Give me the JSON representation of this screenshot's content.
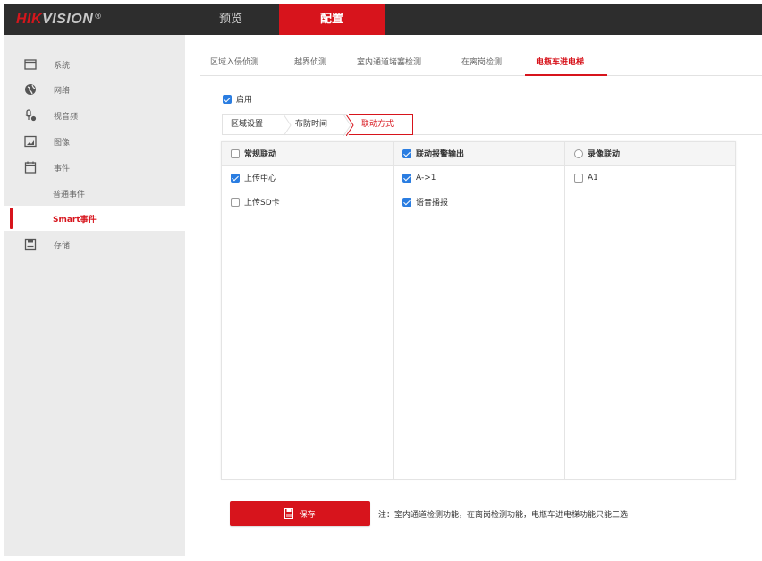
{
  "header": {
    "logo_brand": "HIK",
    "logo_rest": "VISION",
    "logo_mark": "®",
    "nav": [
      {
        "label": "预览",
        "active": false
      },
      {
        "label": "配置",
        "active": true
      }
    ],
    "accent_color": "#d7141c",
    "bar_color": "#2d2d2d"
  },
  "sidebar": {
    "items": [
      {
        "label": "系统",
        "icon": "monitor-icon"
      },
      {
        "label": "网络",
        "icon": "globe-icon"
      },
      {
        "label": "视音频",
        "icon": "audio-video-icon"
      },
      {
        "label": "图像",
        "icon": "image-icon"
      },
      {
        "label": "事件",
        "icon": "calendar-icon"
      },
      {
        "label": "存储",
        "icon": "storage-icon"
      }
    ],
    "sub_items": [
      {
        "label": "普通事件",
        "active": false
      },
      {
        "label": "Smart事件",
        "active": true
      }
    ]
  },
  "tabs": [
    {
      "label": "区域入侵侦测",
      "active": false
    },
    {
      "label": "越界侦测",
      "active": false
    },
    {
      "label": "室内通道堵塞检测",
      "active": false
    },
    {
      "label": "在离岗检测",
      "active": false
    },
    {
      "label": "电瓶车进电梯",
      "active": true
    }
  ],
  "enable": {
    "label": "启用",
    "checked": true
  },
  "steps": [
    {
      "label": "区域设置",
      "active": false
    },
    {
      "label": "布防时间",
      "active": false
    },
    {
      "label": "联动方式",
      "active": true
    }
  ],
  "linkage": {
    "columns": [
      {
        "header": "常规联动",
        "checked": false,
        "items": [
          {
            "label": "上传中心",
            "checked": true
          },
          {
            "label": "上传SD卡",
            "checked": false
          }
        ]
      },
      {
        "header": "联动报警输出",
        "checked": true,
        "items": [
          {
            "label": "A->1",
            "checked": true
          },
          {
            "label": "语音播报",
            "checked": true
          }
        ]
      },
      {
        "header": "录像联动",
        "checked": false,
        "items": [
          {
            "label": "A1",
            "checked": false
          }
        ]
      }
    ]
  },
  "footer": {
    "save_label": "保存",
    "note": "注：室内通道检测功能，在离岗检测功能，电瓶车进电梯功能只能三选一"
  }
}
